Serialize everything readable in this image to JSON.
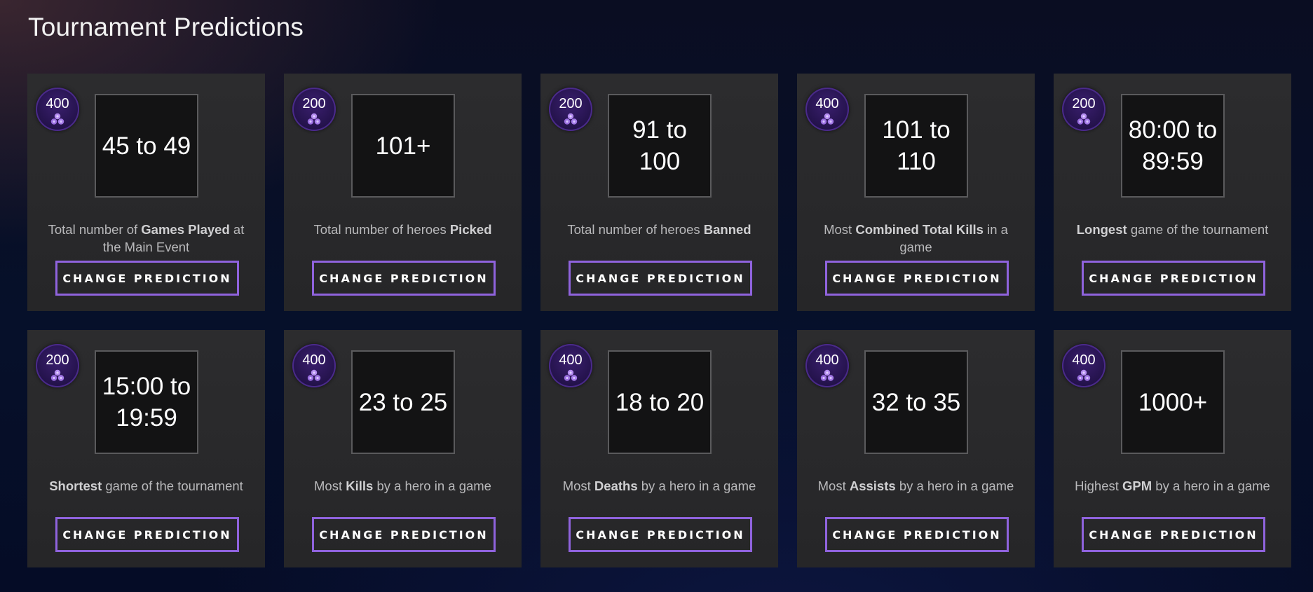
{
  "page": {
    "title": "Tournament Predictions"
  },
  "colors": {
    "accent": "#8f63dd",
    "badge": "#23124a",
    "card": "#2a2a2c"
  },
  "button_label": "CHANGE PREDICTION",
  "badge_icon": "crystal-cluster-icon",
  "cards": [
    {
      "points": "400",
      "value": "45 to 49",
      "desc_pre": "Total number of ",
      "desc_bold": "Games Played",
      "desc_post": " at the Main Event"
    },
    {
      "points": "200",
      "value": "101+",
      "desc_pre": "Total number of heroes ",
      "desc_bold": "Picked",
      "desc_post": ""
    },
    {
      "points": "200",
      "value": "91 to 100",
      "desc_pre": "Total number of heroes ",
      "desc_bold": "Banned",
      "desc_post": ""
    },
    {
      "points": "400",
      "value": "101 to 110",
      "desc_pre": "Most ",
      "desc_bold": "Combined Total Kills",
      "desc_post": " in a game"
    },
    {
      "points": "200",
      "value": "80:00 to 89:59",
      "desc_pre": "",
      "desc_bold": "Longest",
      "desc_post": " game of the tournament"
    },
    {
      "points": "200",
      "value": "15:00 to 19:59",
      "desc_pre": "",
      "desc_bold": "Shortest",
      "desc_post": " game of the tournament"
    },
    {
      "points": "400",
      "value": "23 to 25",
      "desc_pre": "Most ",
      "desc_bold": "Kills",
      "desc_post": " by a hero in a game"
    },
    {
      "points": "400",
      "value": "18 to 20",
      "desc_pre": "Most ",
      "desc_bold": "Deaths",
      "desc_post": " by a hero in a game"
    },
    {
      "points": "400",
      "value": "32 to 35",
      "desc_pre": "Most ",
      "desc_bold": "Assists",
      "desc_post": " by a hero in a game"
    },
    {
      "points": "400",
      "value": "1000+",
      "desc_pre": "Highest ",
      "desc_bold": "GPM",
      "desc_post": " by a hero in a game"
    }
  ]
}
